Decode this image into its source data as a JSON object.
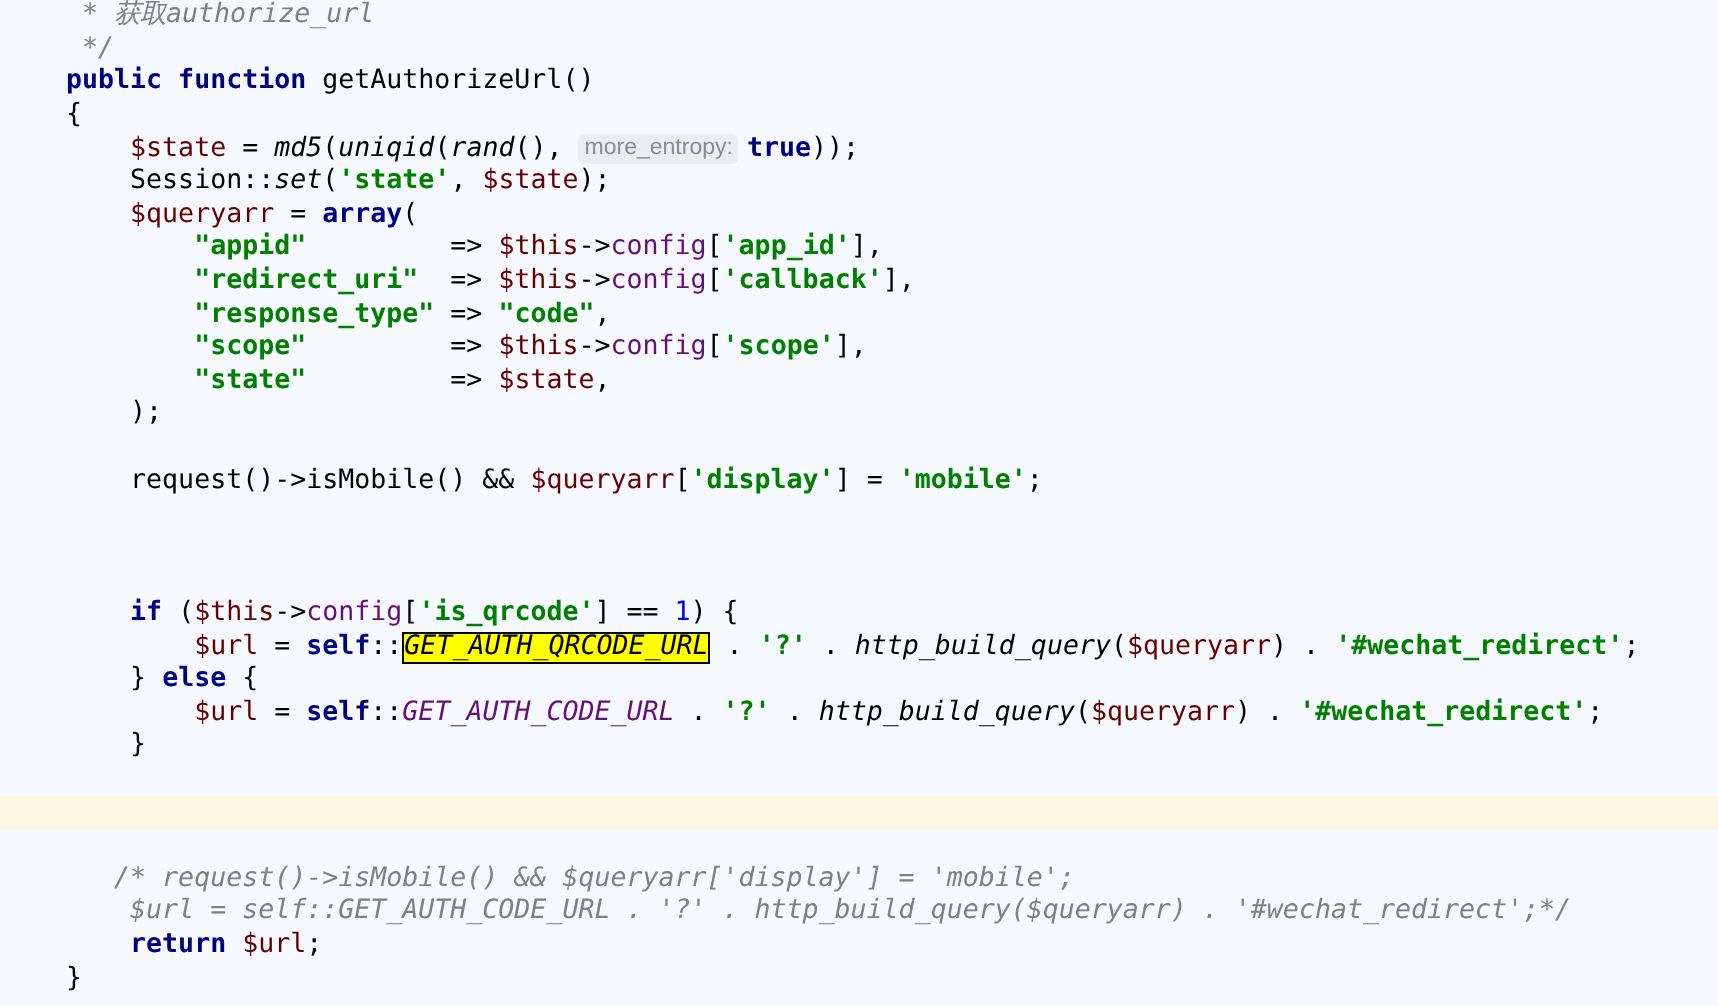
{
  "editor": {
    "lines": [
      {
        "current": false,
        "tokens": [
          {
            "kind": "comment",
            "text": "     * 获取authorize_url"
          }
        ]
      },
      {
        "current": false,
        "tokens": [
          {
            "kind": "comment",
            "text": "     */"
          }
        ]
      },
      {
        "current": false,
        "tokens": [
          {
            "kind": "keyword",
            "text": "    public function "
          },
          {
            "kind": "plain",
            "text": "getAuthorizeUrl()"
          }
        ]
      },
      {
        "current": false,
        "tokens": [
          {
            "kind": "plain",
            "text": "    {"
          }
        ]
      },
      {
        "current": false,
        "tokens": [
          {
            "kind": "variable",
            "text": "        $state"
          },
          {
            "kind": "plain",
            "text": " = "
          },
          {
            "kind": "call",
            "text": "md5"
          },
          {
            "kind": "plain",
            "text": "("
          },
          {
            "kind": "call",
            "text": "uniqid"
          },
          {
            "kind": "plain",
            "text": "("
          },
          {
            "kind": "call",
            "text": "rand"
          },
          {
            "kind": "plain",
            "text": "(), "
          },
          {
            "kind": "hint",
            "text": "more_entropy:"
          },
          {
            "kind": "keyword",
            "text": "true"
          },
          {
            "kind": "plain",
            "text": "));"
          }
        ]
      },
      {
        "current": false,
        "tokens": [
          {
            "kind": "plain",
            "text": "        Session::"
          },
          {
            "kind": "call",
            "text": "set"
          },
          {
            "kind": "plain",
            "text": "("
          },
          {
            "kind": "string",
            "text": "'state'"
          },
          {
            "kind": "plain",
            "text": ", "
          },
          {
            "kind": "variable",
            "text": "$state"
          },
          {
            "kind": "plain",
            "text": ");"
          }
        ]
      },
      {
        "current": false,
        "tokens": [
          {
            "kind": "variable",
            "text": "        $queryarr"
          },
          {
            "kind": "plain",
            "text": " = "
          },
          {
            "kind": "keyword",
            "text": "array"
          },
          {
            "kind": "plain",
            "text": "("
          }
        ]
      },
      {
        "current": false,
        "tokens": [
          {
            "kind": "string",
            "text": "            \"appid\""
          },
          {
            "kind": "plain",
            "text": "         => "
          },
          {
            "kind": "variable",
            "text": "$this"
          },
          {
            "kind": "plain",
            "text": "->"
          },
          {
            "kind": "field",
            "text": "config"
          },
          {
            "kind": "plain",
            "text": "["
          },
          {
            "kind": "string",
            "text": "'app_id'"
          },
          {
            "kind": "plain",
            "text": "],"
          }
        ]
      },
      {
        "current": false,
        "tokens": [
          {
            "kind": "string",
            "text": "            \"redirect_uri\""
          },
          {
            "kind": "plain",
            "text": "  => "
          },
          {
            "kind": "variable",
            "text": "$this"
          },
          {
            "kind": "plain",
            "text": "->"
          },
          {
            "kind": "field",
            "text": "config"
          },
          {
            "kind": "plain",
            "text": "["
          },
          {
            "kind": "string",
            "text": "'callback'"
          },
          {
            "kind": "plain",
            "text": "],"
          }
        ]
      },
      {
        "current": false,
        "tokens": [
          {
            "kind": "string",
            "text": "            \"response_type\""
          },
          {
            "kind": "plain",
            "text": " => "
          },
          {
            "kind": "string",
            "text": "\"code\""
          },
          {
            "kind": "plain",
            "text": ","
          }
        ]
      },
      {
        "current": false,
        "tokens": [
          {
            "kind": "string",
            "text": "            \"scope\""
          },
          {
            "kind": "plain",
            "text": "         => "
          },
          {
            "kind": "variable",
            "text": "$this"
          },
          {
            "kind": "plain",
            "text": "->"
          },
          {
            "kind": "field",
            "text": "config"
          },
          {
            "kind": "plain",
            "text": "["
          },
          {
            "kind": "string",
            "text": "'scope'"
          },
          {
            "kind": "plain",
            "text": "],"
          }
        ]
      },
      {
        "current": false,
        "tokens": [
          {
            "kind": "string",
            "text": "            \"state\""
          },
          {
            "kind": "plain",
            "text": "         => "
          },
          {
            "kind": "variable",
            "text": "$state"
          },
          {
            "kind": "plain",
            "text": ","
          }
        ]
      },
      {
        "current": false,
        "tokens": [
          {
            "kind": "plain",
            "text": "        );"
          }
        ]
      },
      {
        "current": false
      },
      {
        "current": false,
        "tokens": [
          {
            "kind": "plain",
            "text": "        request()->isMobile() && "
          },
          {
            "kind": "variable",
            "text": "$queryarr"
          },
          {
            "kind": "plain",
            "text": "["
          },
          {
            "kind": "string",
            "text": "'display'"
          },
          {
            "kind": "plain",
            "text": "] = "
          },
          {
            "kind": "string",
            "text": "'mobile'"
          },
          {
            "kind": "plain",
            "text": ";"
          }
        ]
      },
      {
        "current": false
      },
      {
        "current": false
      },
      {
        "current": false
      },
      {
        "current": false,
        "tokens": [
          {
            "kind": "keyword",
            "text": "        if "
          },
          {
            "kind": "plain",
            "text": "("
          },
          {
            "kind": "variable",
            "text": "$this"
          },
          {
            "kind": "plain",
            "text": "->"
          },
          {
            "kind": "field",
            "text": "config"
          },
          {
            "kind": "plain",
            "text": "["
          },
          {
            "kind": "string",
            "text": "'is_qrcode'"
          },
          {
            "kind": "plain",
            "text": "] == "
          },
          {
            "kind": "number",
            "text": "1"
          },
          {
            "kind": "plain",
            "text": ") {"
          }
        ]
      },
      {
        "current": false,
        "tokens": [
          {
            "kind": "variable",
            "text": "            $url"
          },
          {
            "kind": "plain",
            "text": " = "
          },
          {
            "kind": "keyword",
            "text": "self"
          },
          {
            "kind": "plain",
            "text": "::"
          },
          {
            "kind": "match",
            "text": "GET_AUTH_QRCODE_URL"
          },
          {
            "kind": "plain",
            "text": " . "
          },
          {
            "kind": "string",
            "text": "'?'"
          },
          {
            "kind": "plain",
            "text": " . "
          },
          {
            "kind": "call",
            "text": "http_build_query"
          },
          {
            "kind": "plain",
            "text": "("
          },
          {
            "kind": "variable",
            "text": "$queryarr"
          },
          {
            "kind": "plain",
            "text": ") . "
          },
          {
            "kind": "string",
            "text": "'#wechat_redirect'"
          },
          {
            "kind": "plain",
            "text": ";"
          }
        ]
      },
      {
        "current": false,
        "tokens": [
          {
            "kind": "plain",
            "text": "        } "
          },
          {
            "kind": "keyword",
            "text": "else"
          },
          {
            "kind": "plain",
            "text": " {"
          }
        ]
      },
      {
        "current": false,
        "tokens": [
          {
            "kind": "variable",
            "text": "            $url"
          },
          {
            "kind": "plain",
            "text": " = "
          },
          {
            "kind": "keyword",
            "text": "self"
          },
          {
            "kind": "plain",
            "text": "::"
          },
          {
            "kind": "constant",
            "text": "GET_AUTH_CODE_URL"
          },
          {
            "kind": "plain",
            "text": " . "
          },
          {
            "kind": "string",
            "text": "'?'"
          },
          {
            "kind": "plain",
            "text": " . "
          },
          {
            "kind": "call",
            "text": "http_build_query"
          },
          {
            "kind": "plain",
            "text": "("
          },
          {
            "kind": "variable",
            "text": "$queryarr"
          },
          {
            "kind": "plain",
            "text": ") . "
          },
          {
            "kind": "string",
            "text": "'#wechat_redirect'"
          },
          {
            "kind": "plain",
            "text": ";"
          }
        ]
      },
      {
        "current": false,
        "tokens": [
          {
            "kind": "plain",
            "text": "        }"
          }
        ]
      },
      {
        "current": false
      },
      {
        "current": true
      },
      {
        "current": false
      },
      {
        "current": false,
        "tokens": [
          {
            "kind": "comment",
            "text": "       /* request()->isMobile() && $queryarr['display'] = 'mobile';"
          }
        ]
      },
      {
        "current": false,
        "tokens": [
          {
            "kind": "comment",
            "text": "        $url = self::GET_AUTH_CODE_URL . '?' . http_build_query($queryarr) . '#wechat_redirect';*/"
          }
        ]
      },
      {
        "current": false,
        "tokens": [
          {
            "kind": "keyword",
            "text": "        return "
          },
          {
            "kind": "variable",
            "text": "$url"
          },
          {
            "kind": "plain",
            "text": ";"
          }
        ]
      },
      {
        "current": false,
        "tokens": [
          {
            "kind": "plain",
            "text": "    }"
          }
        ]
      }
    ]
  }
}
